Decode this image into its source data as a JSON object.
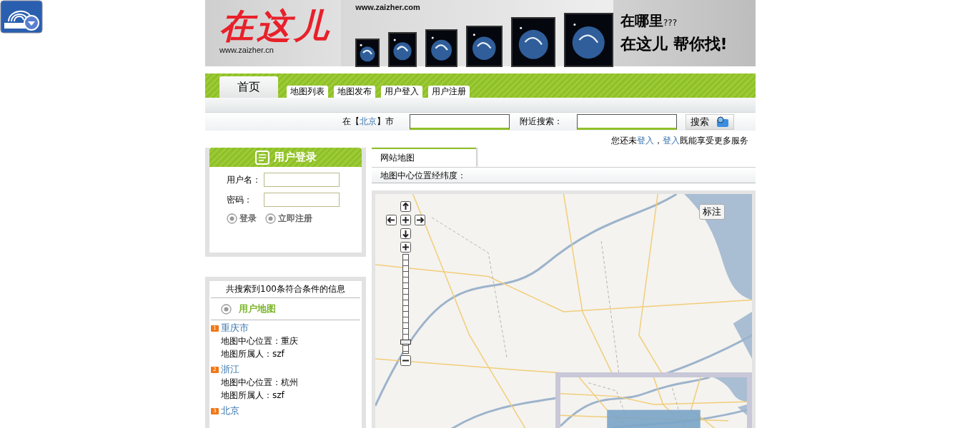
{
  "banner": {
    "logo": "在这儿",
    "logo_url": "www.zaizher.cn",
    "site_url": "www.zaizher.com",
    "slogan_question": "在哪里",
    "slogan_marks": "???",
    "slogan_answer": "在这儿 帮你找!"
  },
  "nav_tabs": [
    {
      "label": "首页",
      "selected": true
    },
    {
      "label": "地图列表",
      "selected": false
    },
    {
      "label": "地图发布",
      "selected": false
    },
    {
      "label": "用户登入",
      "selected": false
    },
    {
      "label": "用户注册",
      "selected": false
    }
  ],
  "search": {
    "city_prefix": "在【",
    "city": "北京",
    "city_suffix": "】市",
    "nearby_label": "附近搜索：",
    "button": "搜索"
  },
  "login_hint": {
    "before": "您还未",
    "link1": "登入",
    "comma": "，",
    "link2": "登入",
    "after": "既能享受更多服务"
  },
  "login_panel": {
    "title": "用户登录",
    "username_label": "用户名：",
    "password_label": "密码：",
    "actions": [
      {
        "label": "登录"
      },
      {
        "label": "立即注册"
      }
    ]
  },
  "results": {
    "summary": "共搜索到100条符合条件的信息",
    "section": "用户地图",
    "items": [
      {
        "rank": "1",
        "title": "重庆市",
        "center": "地图中心位置：重庆",
        "owner": "地图所属人：szf"
      },
      {
        "rank": "2",
        "title": "浙江",
        "center": "地图中心位置：杭州",
        "owner": "地图所属人：szf"
      },
      {
        "rank": "3",
        "title": "北京"
      }
    ]
  },
  "map_panel": {
    "tab": "网站地图",
    "coords_label": "地图中心位置经纬度：",
    "mark_button": "标注",
    "zoom": {
      "level": 0.1
    }
  }
}
